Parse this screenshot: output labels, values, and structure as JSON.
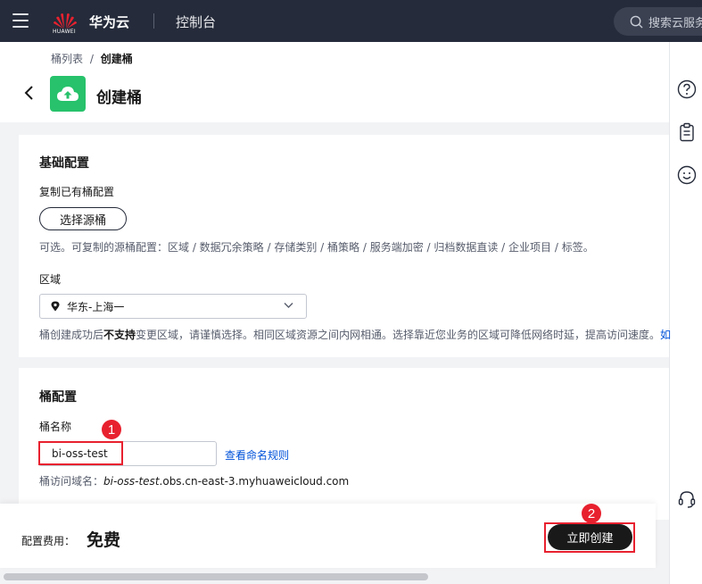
{
  "nav": {
    "logo_text": "HUAWEI",
    "brand": "华为云",
    "console": "控制台",
    "search_placeholder": "搜索云服务"
  },
  "header": {
    "breadcrumb_parent": "桶列表",
    "breadcrumb_sep": "/",
    "breadcrumb_current": "创建桶",
    "title": "创建桶"
  },
  "basic": {
    "title": "基础配置",
    "copy_label": "复制已有桶配置",
    "select_source_button": "选择源桶",
    "copy_hint": "可选。可复制的源桶配置：区域 / 数据冗余策略 / 存储类别 / 桶策略 / 服务端加密 / 归档数据直读 / 企业项目 / 标签。",
    "region_label": "区域",
    "region_value": "华东-上海一",
    "region_hint_pre": "桶创建成功后",
    "region_hint_bold": "不支持",
    "region_hint_post": "变更区域，请谨慎选择。相同区域资源之间内网相通。选择靠近您业务的区域可降低网络时延，提高访问速度。",
    "region_hint_link": "如"
  },
  "bucket": {
    "title": "桶配置",
    "name_label": "桶名称",
    "name_value": "bi-oss-test",
    "naming_rules_link": "查看命名规则",
    "domain_label": "桶访问域名：",
    "domain_bucket": "bi-oss-test",
    "domain_suffix": ".obs.cn-east-3.myhuaweicloud.com"
  },
  "footer": {
    "fee_label": "配置费用：",
    "fee_value": "免费",
    "create_button": "立即创建"
  },
  "annotations": {
    "step1": "1",
    "step2": "2"
  },
  "colors": {
    "nav_bg": "#252b3a",
    "accent_green": "#27c26b",
    "highlight_red": "#e8212f",
    "link_blue": "#0052d9"
  }
}
